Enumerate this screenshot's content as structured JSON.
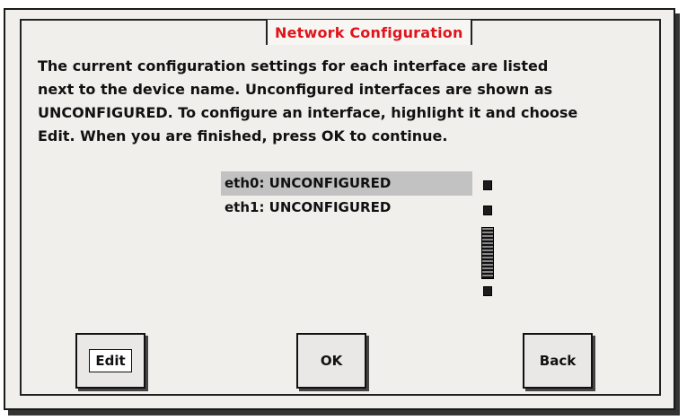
{
  "dialog": {
    "title": "Network Configuration",
    "description_lines": [
      "The current configuration settings for each interface are listed",
      "next to the device name.  Unconfigured interfaces are shown as",
      "UNCONFIGURED. To configure an interface, highlight it and choose",
      "Edit. When you are finished, press OK to continue."
    ],
    "interfaces": [
      {
        "label": "eth0: UNCONFIGURED",
        "selected": true
      },
      {
        "label": "eth1: UNCONFIGURED",
        "selected": false
      }
    ],
    "buttons": {
      "edit": "Edit",
      "ok": "OK",
      "back": "Back"
    },
    "colors": {
      "title": "#e0141c",
      "selection": "#c2c2c2"
    }
  }
}
